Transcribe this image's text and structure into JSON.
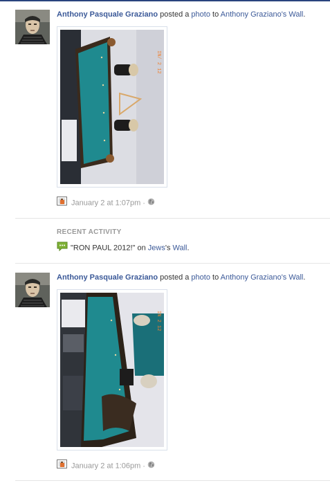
{
  "stories": [
    {
      "actor": "Anthony Pasquale Graziano",
      "verb": "posted a",
      "object_link": "photo",
      "prep": "to",
      "target_link": "Anthony Graziano's Wall",
      "period": ".",
      "timestamp": "January 2 at 1:07pm",
      "separator": "·",
      "privacy_icon": "globe-icon",
      "photo_stamp": "IN/ 2 12"
    },
    {
      "actor": "Anthony Pasquale Graziano",
      "verb": "posted a",
      "object_link": "photo",
      "prep": "to",
      "target_link": "Anthony Graziano's Wall",
      "period": ".",
      "timestamp": "January 2 at 1:06pm",
      "separator": "·",
      "privacy_icon": "globe-icon",
      "photo_stamp": "IN 2 12"
    }
  ],
  "recent_activity": {
    "heading": "RECENT ACTIVITY",
    "item": {
      "quote": "\"RON PAUL 2012!\"",
      "on_text": "on",
      "target": "Jews",
      "suffix": "'s",
      "wall_link": "Wall",
      "period": "."
    }
  },
  "colors": {
    "link": "#3b5998",
    "muted": "#999999",
    "felt": "#1f8a8f",
    "divider": "#e5e5e5"
  }
}
